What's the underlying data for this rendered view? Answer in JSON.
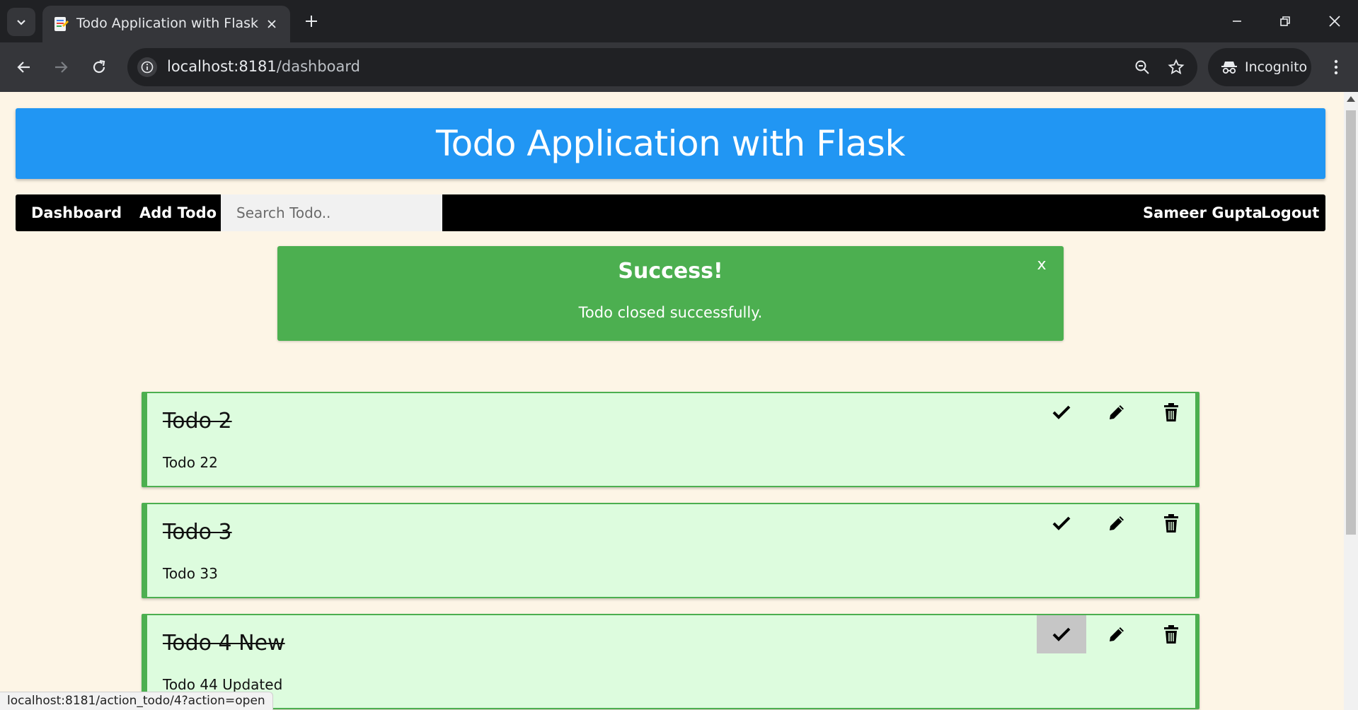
{
  "browser": {
    "tab_title": "Todo Application with Flask",
    "url_host": "localhost:8181",
    "url_path": "/dashboard",
    "incognito_label": "Incognito",
    "status_url": "localhost:8181/action_todo/4?action=open"
  },
  "app": {
    "title": "Todo Application with Flask",
    "nav": {
      "dashboard": "Dashboard",
      "add_todo": "Add Todo",
      "search_placeholder": "Search Todo..",
      "user": "Sameer Gupta",
      "logout": "Logout"
    },
    "alert": {
      "title": "Success!",
      "message": "Todo closed successfully.",
      "close": "x"
    },
    "todos": [
      {
        "title": "Todo 2",
        "description": "Todo 22"
      },
      {
        "title": "Todo 3",
        "description": "Todo 33"
      },
      {
        "title": "Todo 4 New",
        "description": "Todo 44 Updated"
      }
    ]
  },
  "colors": {
    "header": "#2196f3",
    "success": "#4caf50",
    "todo_bg": "#ddfcde",
    "page_bg": "#fdf5e6"
  }
}
